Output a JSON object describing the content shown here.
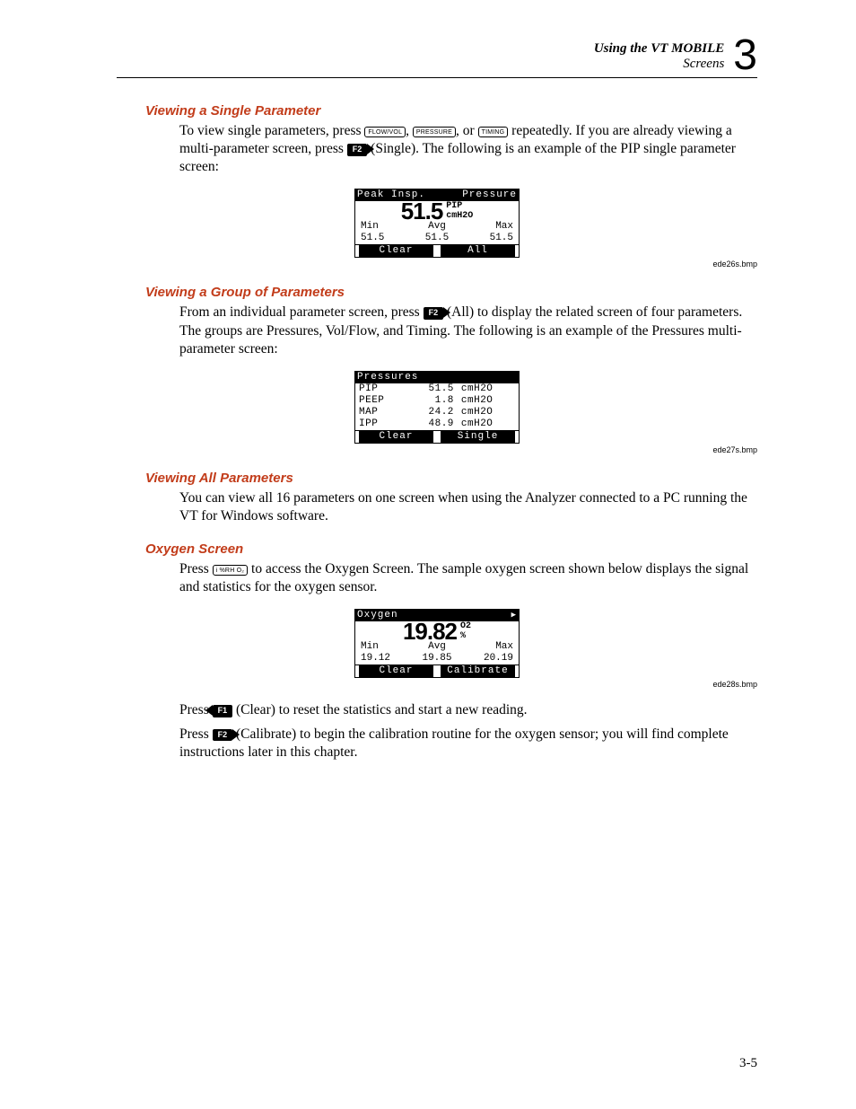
{
  "header": {
    "line1": "Using the VT MOBILE",
    "line2": "Screens",
    "chapter": "3"
  },
  "sections": {
    "single": {
      "title": "Viewing a Single Parameter",
      "para": "To view single parameters, press ",
      "key1": "FLOW/VOL",
      "key2": "PRESSURE",
      "key3": "TIMING",
      "mid1": ", ",
      "mid2": ", or ",
      "after_keys": " repeatedly. If you are already viewing a multi-parameter screen, press ",
      "fkey": "F2",
      "after_fkey": " (Single). The following is an example of the PIP single parameter screen:"
    },
    "fig1": {
      "title_l": "Peak Insp.",
      "title_r": "Pressure",
      "big": "51.5",
      "unit_top": "PIP",
      "unit_bot": "cmH2O",
      "min_l": "Min",
      "avg_l": "Avg",
      "max_l": "Max",
      "min": "51.5",
      "avg": "51.5",
      "max": "51.5",
      "foot_l": "Clear",
      "foot_r": "All",
      "caption": "ede26s.bmp"
    },
    "group": {
      "title": "Viewing a Group of Parameters",
      "para1": "From an individual parameter screen, press ",
      "fkey": "F2",
      "para2": " (All) to display the related screen of four parameters. The groups are Pressures, Vol/Flow, and Timing. The following is an example of the Pressures multi-parameter screen:"
    },
    "fig2": {
      "title": "Pressures",
      "rows": [
        {
          "n": "PIP",
          "v": "51.5",
          "u": "cmH2O"
        },
        {
          "n": "PEEP",
          "v": "1.8",
          "u": "cmH2O"
        },
        {
          "n": "MAP",
          "v": "24.2",
          "u": "cmH2O"
        },
        {
          "n": "IPP",
          "v": "48.9",
          "u": "cmH2O"
        }
      ],
      "foot_l": "Clear",
      "foot_r": "Single",
      "caption": "ede27s.bmp"
    },
    "all": {
      "title": "Viewing All Parameters",
      "para": "You can view all 16 parameters on one screen when using the Analyzer connected to a PC running the VT for Windows software."
    },
    "oxygen": {
      "title": "Oxygen Screen",
      "para1a": "Press ",
      "key": "i %RH O₂",
      "para1b": " to access the Oxygen Screen. The sample oxygen screen shown below displays the signal and statistics for the oxygen sensor."
    },
    "fig3": {
      "title": "Oxygen",
      "arrow": "▶",
      "big": "19.82",
      "unit_top": "O2",
      "unit_bot": "%",
      "min_l": "Min",
      "avg_l": "Avg",
      "max_l": "Max",
      "min": "19.12",
      "avg": "19.85",
      "max": "20.19",
      "foot_l": "Clear",
      "foot_r": "Calibrate",
      "caption": "ede28s.bmp"
    },
    "oxygen2": {
      "p1a": "Press ",
      "f1": "F1",
      "p1b": " (Clear) to reset the statistics and start a new reading.",
      "p2a": "Press ",
      "f2": "F2",
      "p2b": " (Calibrate) to begin the calibration routine for the oxygen sensor; you will find complete instructions later in this chapter."
    }
  },
  "pagenum": "3-5"
}
